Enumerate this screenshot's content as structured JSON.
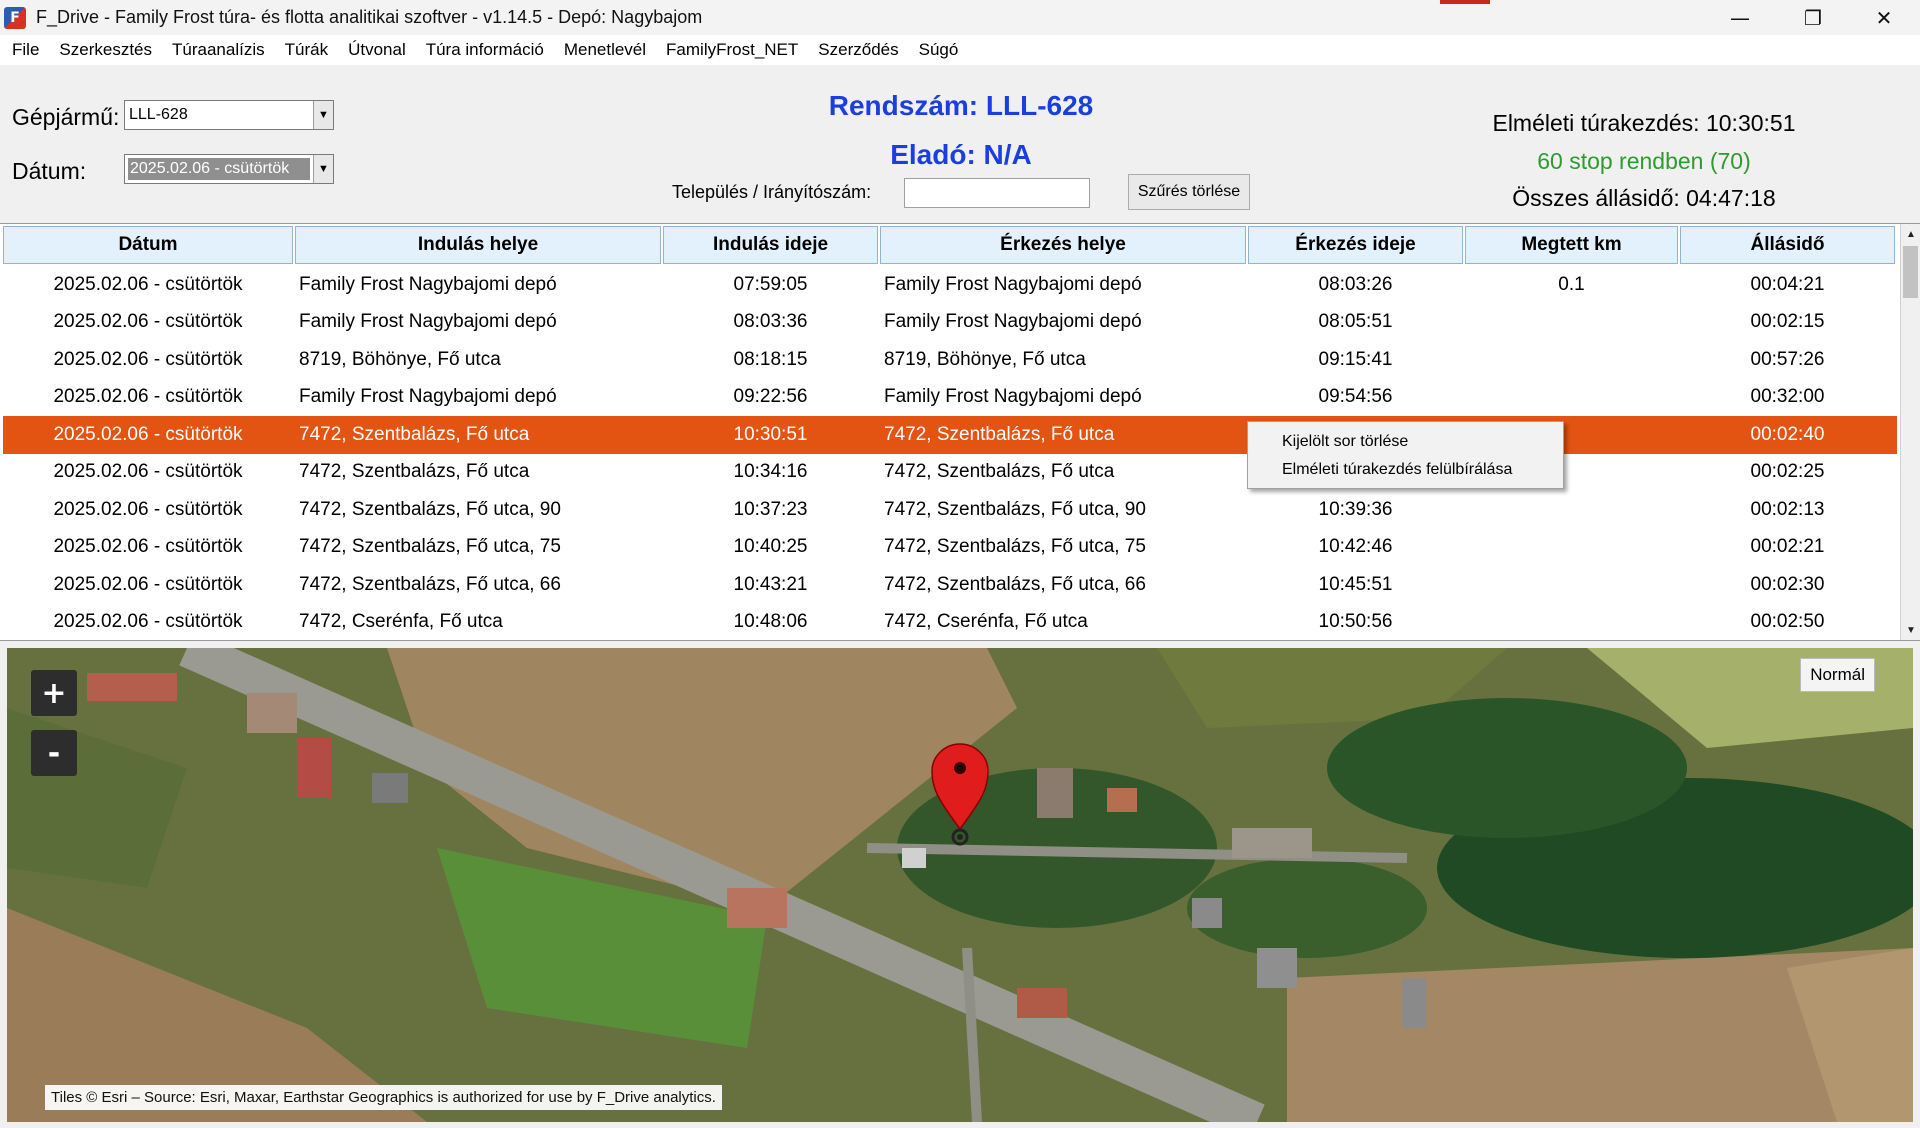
{
  "window": {
    "title": "F_Drive - Family Frost túra- és flotta analitikai szoftver - v1.14.5 - Depó: Nagybajom",
    "icon_letter": "F",
    "controls": {
      "minimize": "—",
      "restore": "❐",
      "close": "✕"
    }
  },
  "menu": [
    "File",
    "Szerkesztés",
    "Túraanalízis",
    "Túrák",
    "Útvonal",
    "Túra információ",
    "Menetlevél",
    "FamilyFrost_NET",
    "Szerződés",
    "Súgó"
  ],
  "filters": {
    "vehicle_label": "Gépjármű:",
    "vehicle_value": "LLL-628",
    "date_label": "Dátum:",
    "date_value": "2025.02.06 - csütörtök",
    "settlement_label": "Település / Irányítószám:",
    "settlement_value": "",
    "clear_button": "Szűrés törlése"
  },
  "header": {
    "plate": "Rendszám: LLL-628",
    "seller": "Eladó: N/A"
  },
  "summary": {
    "theoretical_start": "Elméleti túrakezdés: 10:30:51",
    "stops_ok": "60 stop rendben (70)",
    "total_idle": "Összes állásidő: 04:47:18",
    "stops_color": "#2e9b2e"
  },
  "table": {
    "columns": [
      "Dátum",
      "Indulás helye",
      "Indulás ideje",
      "Érkezés helye",
      "Érkezés ideje",
      "Megtett km",
      "Állásidő"
    ],
    "selected_index": 4,
    "rows": [
      [
        "2025.02.06 - csütörtök",
        "Family Frost Nagybajomi depó",
        "07:59:05",
        "Family Frost Nagybajomi depó",
        "08:03:26",
        "0.1",
        "00:04:21"
      ],
      [
        "2025.02.06 - csütörtök",
        "Family Frost Nagybajomi depó",
        "08:03:36",
        "Family Frost Nagybajomi depó",
        "08:05:51",
        "",
        "00:02:15"
      ],
      [
        "2025.02.06 - csütörtök",
        "8719, Böhönye, Fő utca",
        "08:18:15",
        "8719, Böhönye, Fő utca",
        "09:15:41",
        "",
        "00:57:26"
      ],
      [
        "2025.02.06 - csütörtök",
        "Family Frost Nagybajomi depó",
        "09:22:56",
        "Family Frost Nagybajomi depó",
        "09:54:56",
        "",
        "00:32:00"
      ],
      [
        "2025.02.06 - csütörtök",
        "7472, Szentbalázs, Fő utca",
        "10:30:51",
        "7472, Szentbalázs, Fő utca",
        "",
        "",
        "00:02:40"
      ],
      [
        "2025.02.06 - csütörtök",
        "7472, Szentbalázs, Fő utca",
        "10:34:16",
        "7472, Szentbalázs, Fő utca",
        "",
        "",
        "00:02:25"
      ],
      [
        "2025.02.06 - csütörtök",
        "7472, Szentbalázs, Fő utca, 90",
        "10:37:23",
        "7472, Szentbalázs, Fő utca, 90",
        "10:39:36",
        "",
        "00:02:13"
      ],
      [
        "2025.02.06 - csütörtök",
        "7472, Szentbalázs, Fő utca, 75",
        "10:40:25",
        "7472, Szentbalázs, Fő utca, 75",
        "10:42:46",
        "",
        "00:02:21"
      ],
      [
        "2025.02.06 - csütörtök",
        "7472, Szentbalázs, Fő utca, 66",
        "10:43:21",
        "7472, Szentbalázs, Fő utca, 66",
        "10:45:51",
        "",
        "00:02:30"
      ],
      [
        "2025.02.06 - csütörtök",
        "7472, Cserénfa, Fő utca",
        "10:48:06",
        "7472, Cserénfa, Fő utca",
        "10:50:56",
        "",
        "00:02:50"
      ]
    ]
  },
  "context_menu": [
    "Kijelölt sor törlése",
    "Elméleti túrakezdés felülbírálása"
  ],
  "map": {
    "zoom_in": "+",
    "zoom_out": "-",
    "mode": "Normál",
    "attribution": "Tiles © Esri – Source: Esri, Maxar, Earthstar Geographics is authorized for use by F_Drive analytics.",
    "marker_icon": "map-pin-icon"
  },
  "colors": {
    "accent_blue": "#1a3ee0",
    "selected_row": "#e35412",
    "header_bg": "#e3f1fc"
  }
}
